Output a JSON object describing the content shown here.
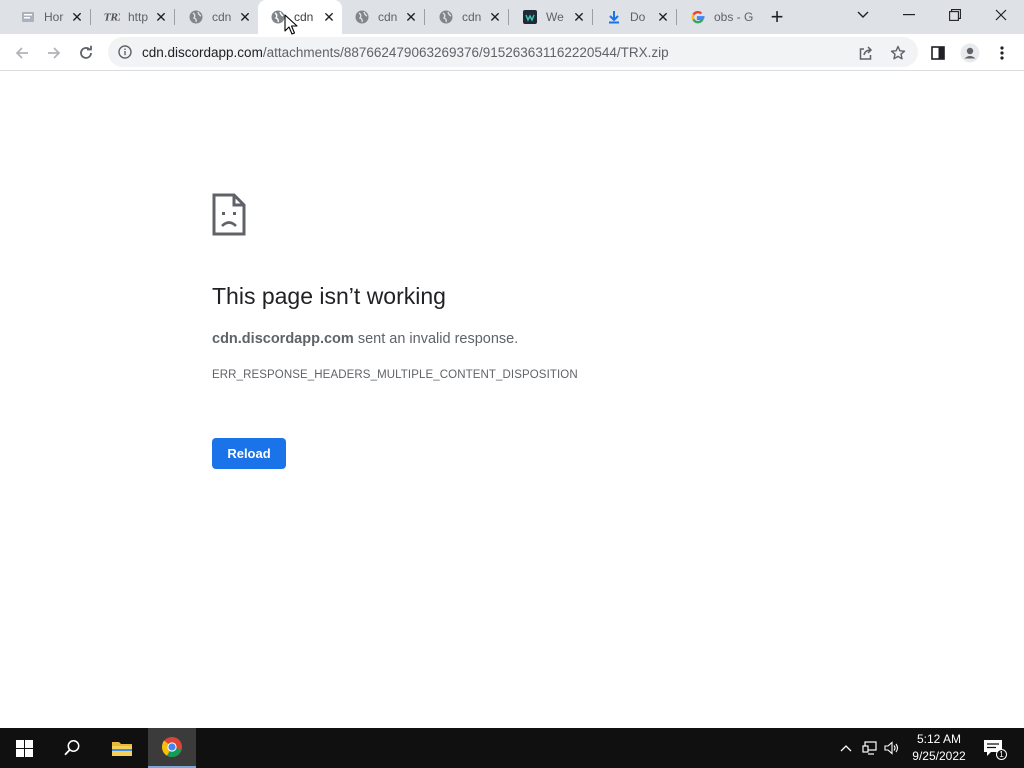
{
  "tabs": [
    {
      "title": "Hor",
      "icon": "document-icon"
    },
    {
      "title": "http",
      "icon": "trx-icon"
    },
    {
      "title": "cdn",
      "icon": "globe-icon"
    },
    {
      "title": "cdn",
      "icon": "globe-icon",
      "active": true
    },
    {
      "title": "cdn",
      "icon": "globe-icon"
    },
    {
      "title": "cdn",
      "icon": "globe-icon"
    },
    {
      "title": "We",
      "icon": "app-icon"
    },
    {
      "title": "Do",
      "icon": "download-icon"
    },
    {
      "title": "obs - Gc",
      "icon": "google-icon"
    }
  ],
  "address_bar": {
    "host": "cdn.discordapp.com",
    "path": "/attachments/887662479063269376/915263631162220544/TRX.zip"
  },
  "error_page": {
    "title": "This page isn’t working",
    "host": "cdn.discordapp.com",
    "message": " sent an invalid response.",
    "code": "ERR_RESPONSE_HEADERS_MULTIPLE_CONTENT_DISPOSITION",
    "reload_label": "Reload"
  },
  "taskbar": {
    "time": "5:12 AM",
    "date": "9/25/2022",
    "notification_count": "1"
  },
  "colors": {
    "accent": "#1a73e8",
    "tabstrip": "#dee1e6",
    "taskbar": "#101010"
  }
}
